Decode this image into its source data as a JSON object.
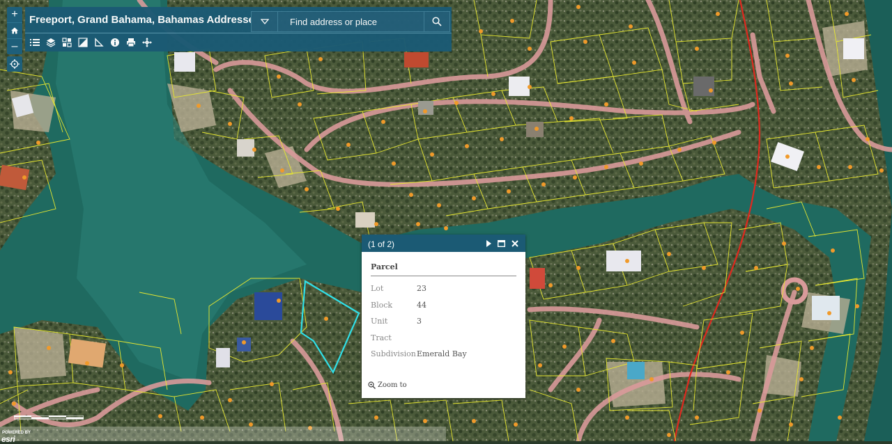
{
  "header": {
    "title": "Freeport, Grand Bahama, Bahamas Addresses",
    "search_placeholder": "Find address or place"
  },
  "zoom": {
    "in_label": "+",
    "home_label": "⌂",
    "out_label": "–"
  },
  "toolbar": {
    "tools": [
      "list-icon",
      "layers-icon",
      "basemap-icon",
      "swipe-icon",
      "measure-icon",
      "info-icon",
      "print-icon",
      "move-icon"
    ]
  },
  "popup": {
    "count": "(1 of 2)",
    "title": "Parcel",
    "fields": [
      {
        "key": "Lot",
        "value": "23"
      },
      {
        "key": "Block",
        "value": "44"
      },
      {
        "key": "Unit",
        "value": "3"
      },
      {
        "key": "Tract",
        "value": ""
      },
      {
        "key": "Subdivision",
        "value": "Emerald Bay"
      }
    ],
    "zoom_to": "Zoom to"
  },
  "attribution": {
    "powered_by": "POWERED BY",
    "brand": "esri"
  },
  "colors": {
    "header": "#1b5a74",
    "water": "#1f6a60",
    "land": "#4a5a38",
    "parcel_line": "#e8e830",
    "road": "#d99a9a",
    "highway": "#e0281e",
    "selected_parcel": "#30e0e8",
    "address_point": "#f09a2a"
  }
}
